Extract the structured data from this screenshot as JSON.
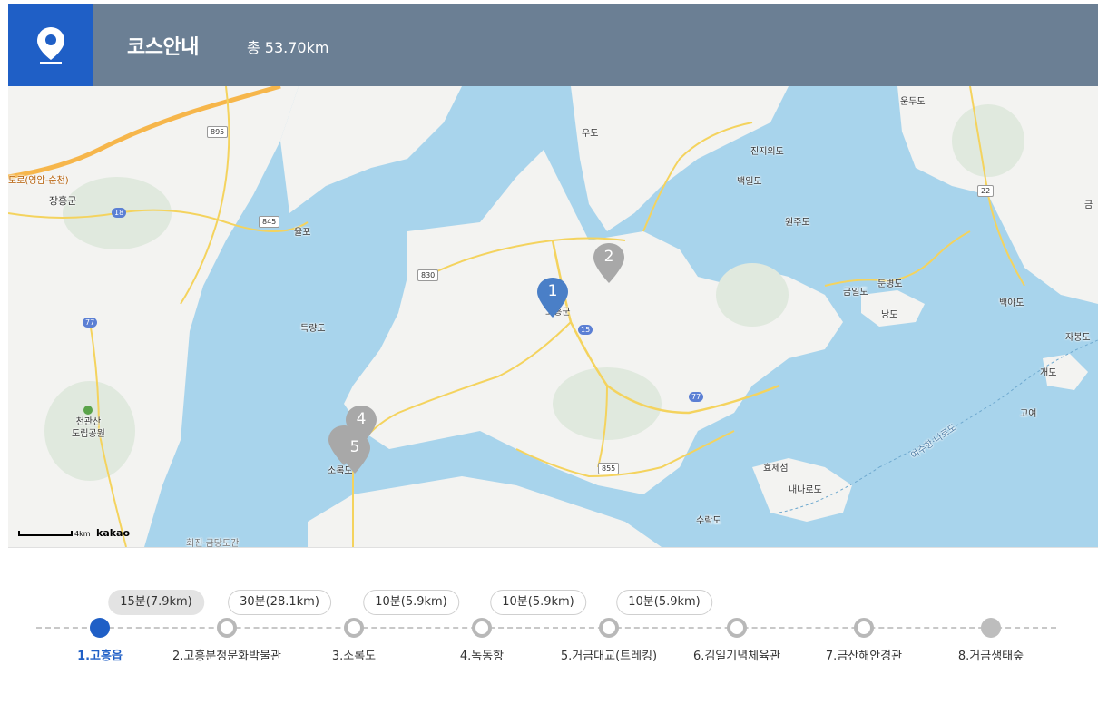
{
  "header": {
    "title": "코스안내",
    "total_distance": "총 53.70km",
    "icon": "location-pin-icon"
  },
  "map": {
    "labels": {
      "jangheung": "장흥군",
      "yulpo": "율포",
      "deungryangdo": "득량도",
      "woodo": "우도",
      "jinjido": "진지외도",
      "baegildo": "백일도",
      "wonjudo": "원주도",
      "geumildo": "금일도",
      "dunbyeongdo": "둔병도",
      "nangdo": "낭도",
      "baegyado": "백야도",
      "jabongdo": "자봉도",
      "gaedo": "개도",
      "goyeo": "고여",
      "hwajeong": "효제섬",
      "nanarodo": "내나로도",
      "surakdo": "수락도",
      "sorokdo": "소록도",
      "cheonkwansan": "천관산\n도립공원",
      "gogung": "고흥군",
      "undudo": "운두도",
      "yeosu_route": "여수항·나로도",
      "bridge": "회진·금당도간",
      "highway": "도로(영암-순천)",
      "jangheung_geum": "금"
    },
    "routes": {
      "r895": "895",
      "r845": "845",
      "r18": "18",
      "r77a": "77",
      "r830": "830",
      "r15": "15",
      "r77b": "77",
      "r855": "855",
      "r22": "22"
    },
    "markers": [
      {
        "num": "1",
        "color": "#4a7fc7"
      },
      {
        "num": "2",
        "color": "#a8a8a8"
      },
      {
        "num": "4",
        "color": "#a8a8a8"
      },
      {
        "num": "5",
        "color": "#a8a8a8"
      }
    ],
    "scale_text": "4km",
    "brand": "kakao"
  },
  "timeline": {
    "durations": [
      "15분(7.9km)",
      "30분(28.1km)",
      "10분(5.9km)",
      "10분(5.9km)",
      "10분(5.9km)"
    ],
    "stops": [
      "1.고흥읍",
      "2.고흥분청문화박물관",
      "3.소록도",
      "4.녹동항",
      "5.거금대교(트레킹)",
      "6.김일기념체육관",
      "7.금산해안경관",
      "8.거금생태숲"
    ],
    "active_stop": 1,
    "colors": {
      "active": "#1f5fc6",
      "ring": "#b8b8b8",
      "last": "#bdbdbd"
    }
  }
}
